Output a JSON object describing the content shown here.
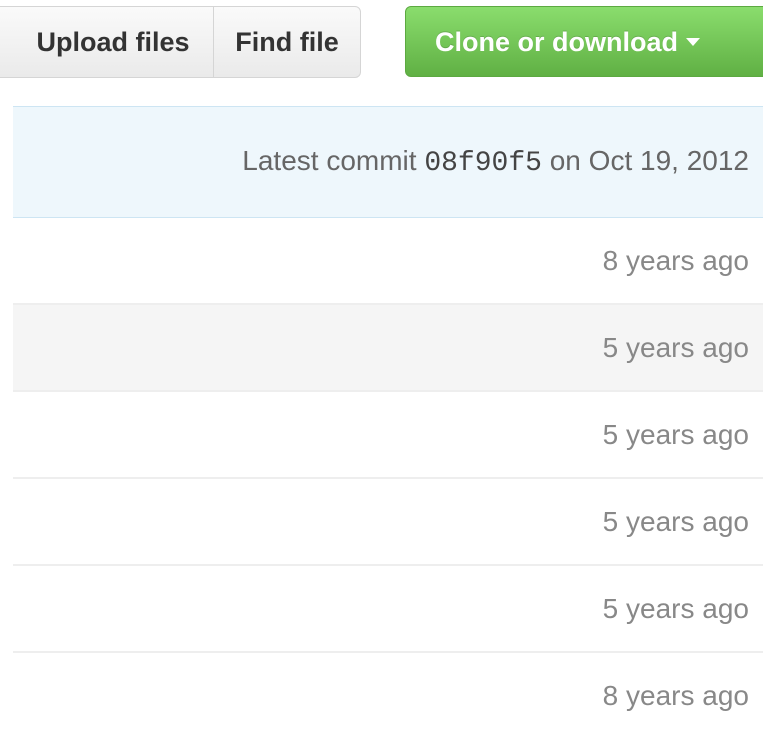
{
  "toolbar": {
    "upload_label": "Upload files",
    "find_label": "Find file",
    "clone_label": "Clone or download"
  },
  "commit": {
    "prefix": "Latest commit",
    "sha": "08f90f5",
    "suffix": "on Oct 19, 2012"
  },
  "rows": [
    {
      "age": "8 years ago"
    },
    {
      "age": "5 years ago"
    },
    {
      "age": "5 years ago"
    },
    {
      "age": "5 years ago"
    },
    {
      "age": "5 years ago"
    },
    {
      "age": "8 years ago"
    }
  ],
  "colors": {
    "clone_green": "#60b044",
    "commit_bar_bg": "#eef7fc",
    "hover_row_bg": "#f5f5f5"
  }
}
